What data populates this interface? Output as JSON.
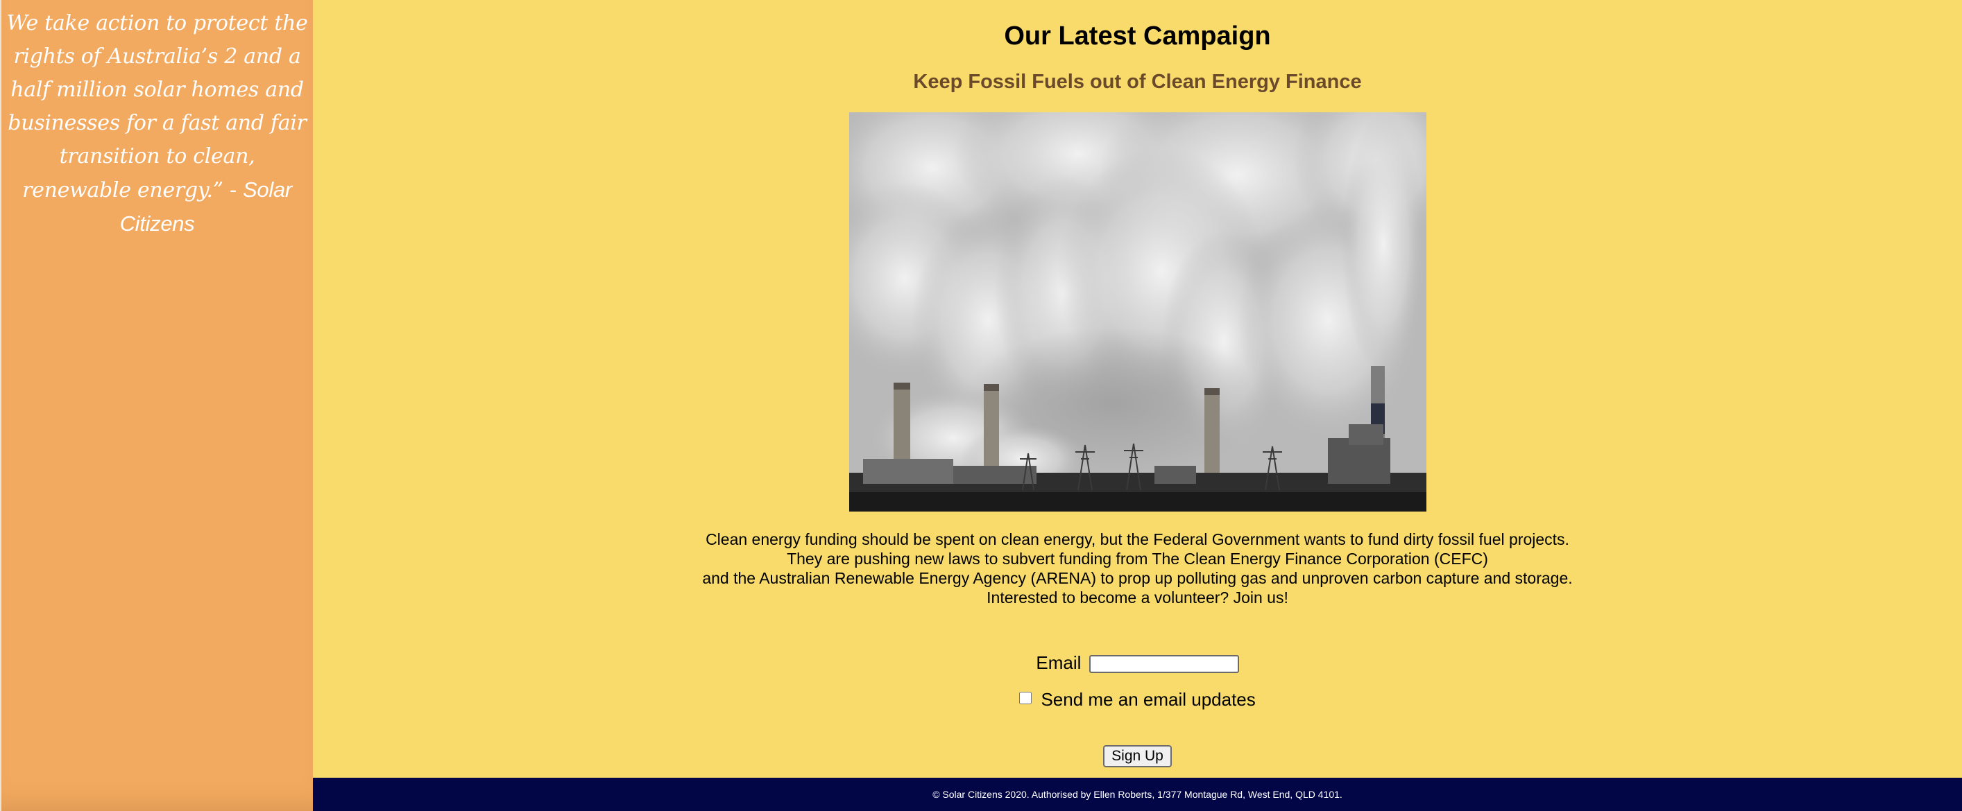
{
  "sidebar": {
    "quote_text": "We take action to protect the rights of Australia’s 2 and a half million solar homes and businesses for a fast and fair transition to clean, renewable energy.” - ",
    "quote_attribution": "Solar Citizens"
  },
  "main": {
    "title": "Our Latest Campaign",
    "subtitle": "Keep Fossil Fuels out of Clean Energy Finance",
    "image_subject": "industrial smokestacks emitting smoke",
    "description_lines": [
      "Clean energy funding should be spent on clean energy, but the Federal Government wants to fund dirty fossil fuel projects.",
      "They are pushing new laws to subvert funding from The Clean Energy Finance Corporation (CEFC)",
      "and the Australian Renewable Energy Agency (ARENA) to prop up polluting gas and unproven carbon capture and storage.",
      "Interested to become a volunteer? Join us!"
    ]
  },
  "form": {
    "email_label": "Email",
    "email_value": "",
    "updates_label": "Send me an email updates",
    "updates_checked": false,
    "submit_label": "Sign Up"
  },
  "footer": {
    "text": "© Solar Citizens 2020. Authorised by Ellen Roberts, 1/377 Montague Rd, West End, QLD 4101."
  },
  "colors": {
    "page_background": "#f9db6b",
    "sidebar_background": "#f2a960",
    "subtitle": "#6b4a2b",
    "footer_background": "#020546"
  }
}
